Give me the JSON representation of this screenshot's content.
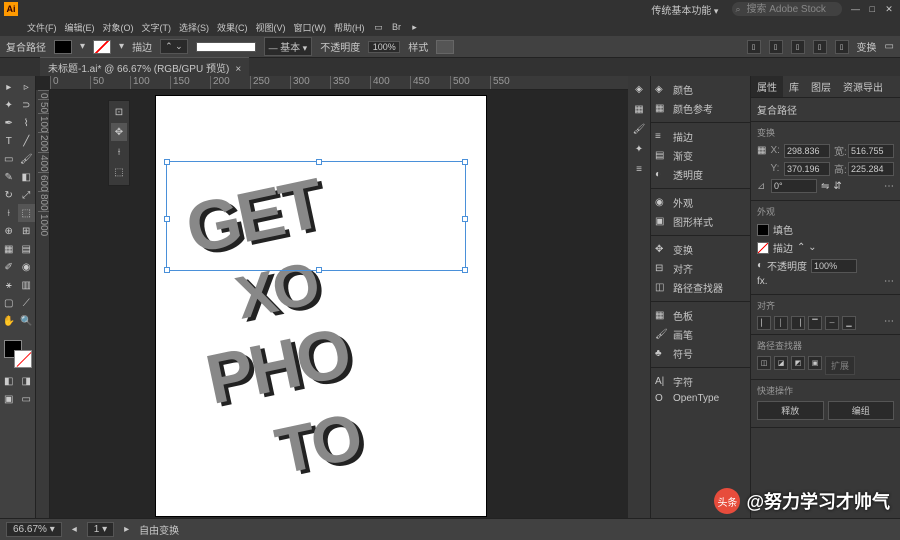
{
  "app": {
    "logo": "Ai",
    "workspace": "传统基本功能",
    "search_placeholder": "搜索 Adobe Stock"
  },
  "menu": {
    "items": [
      "文件(F)",
      "编辑(E)",
      "对象(O)",
      "文字(T)",
      "选择(S)",
      "效果(C)",
      "视图(V)",
      "窗口(W)",
      "帮助(H)"
    ]
  },
  "control": {
    "label": "复合路径",
    "stroke_label": "描边",
    "stroke_val": "",
    "basic": "基本",
    "opacity_label": "不透明度",
    "opacity_val": "100%",
    "style_label": "样式",
    "transform_label": "变换"
  },
  "tab": {
    "title": "未标题-1.ai* @ 66.67% (RGB/GPU 预览)"
  },
  "ruler_h": [
    "0",
    "50",
    "100",
    "150",
    "200",
    "250",
    "300",
    "350",
    "400",
    "450",
    "500",
    "550"
  ],
  "ruler_v": [
    "0",
    "50",
    "100",
    "200",
    "400",
    "600",
    "800",
    "1000"
  ],
  "artwork": {
    "l1": "GET",
    "l2": "XO",
    "l3": "PHO",
    "l4": "TO"
  },
  "panels2": {
    "group1": [
      "颜色",
      "颜色参考"
    ],
    "group2": [
      "描边",
      "渐变",
      "透明度"
    ],
    "group3": [
      "外观",
      "图形样式"
    ],
    "group4": [
      "变换",
      "对齐",
      "路径查找器"
    ],
    "group5": [
      "色板",
      "画笔",
      "符号"
    ],
    "group6": [
      "字符",
      "OpenType"
    ]
  },
  "props": {
    "tabs": [
      "属性",
      "库",
      "图层",
      "资源导出"
    ],
    "objtype": "复合路径",
    "transform_title": "变换",
    "x": "298.836",
    "w": "516.755",
    "y": "370.196",
    "h": "225.284",
    "angle": "0°",
    "appearance_title": "外观",
    "fill_label": "填色",
    "stroke_label": "描边",
    "opacity_label": "不透明度",
    "opacity_val": "100%",
    "align_title": "对齐",
    "pathfinder_title": "路径查找器",
    "expand": "扩展",
    "quick_title": "快速操作",
    "btn1": "释放",
    "btn2": "编组"
  },
  "status": {
    "zoom": "66.67%",
    "tool": "自由变换"
  },
  "watermark": {
    "src": "头条",
    "author": "@努力学习才帅气"
  }
}
